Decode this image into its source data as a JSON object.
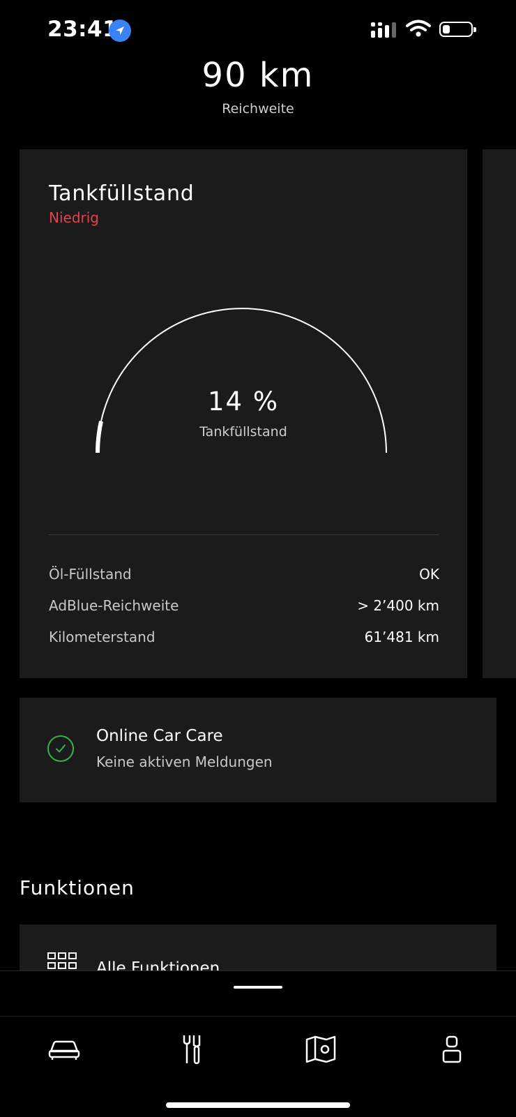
{
  "status_bar": {
    "time": "23:41",
    "icons": [
      "location-arrow-icon",
      "cellular-signal-icon",
      "wifi-icon",
      "battery-icon"
    ],
    "battery_level": 0.25
  },
  "range": {
    "value": "90 km",
    "label": "Reichweite"
  },
  "fuel_card": {
    "title": "Tankfüllstand",
    "status": "Niedrig",
    "status_color": "#e5414d",
    "gauge_value": "14 %",
    "gauge_fraction": 0.14,
    "gauge_label": "Tankfüllstand",
    "rows": [
      {
        "label": "Öl-Füllstand",
        "value": "OK"
      },
      {
        "label": "AdBlue-Reichweite",
        "value": "> 2’400 km"
      },
      {
        "label": "Kilometerstand",
        "value": "61’481 km"
      }
    ]
  },
  "care_card": {
    "title": "Online Car Care",
    "subtitle": "Keine aktiven Meldungen",
    "icon": "checkmark-circle-icon",
    "accent_color": "#33b54a"
  },
  "functions": {
    "section_title": "Funktionen",
    "all_label": "Alle Funktionen",
    "icon": "grid-icon"
  },
  "bottom_nav": {
    "items": [
      "car-icon",
      "tools-icon",
      "map-icon",
      "profile-icon"
    ]
  }
}
